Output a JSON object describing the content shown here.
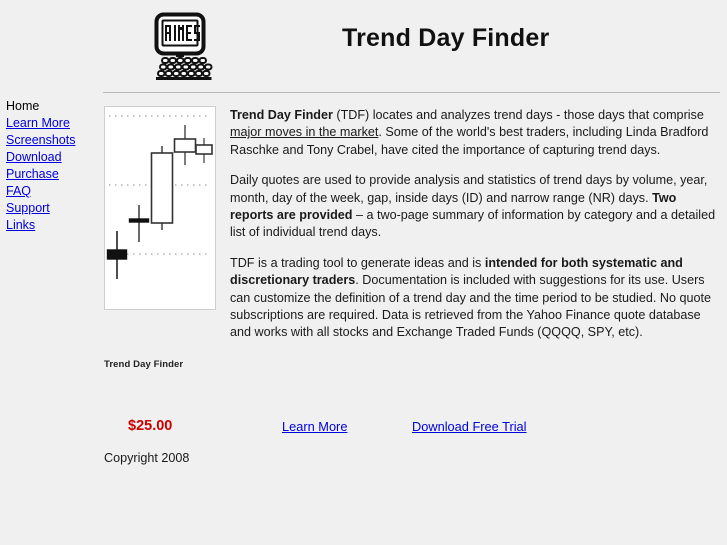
{
  "header": {
    "title": "Trend Day Finder",
    "logo_text": "AIMES",
    "logo_icon": "computer-monitor-keyboard-icon"
  },
  "sidebar": {
    "items": [
      {
        "label": "Home",
        "current": true
      },
      {
        "label": "Learn More",
        "current": false
      },
      {
        "label": "Screenshots",
        "current": false
      },
      {
        "label": "Download",
        "current": false
      },
      {
        "label": "Purchase",
        "current": false
      },
      {
        "label": "FAQ",
        "current": false
      },
      {
        "label": "Support",
        "current": false
      },
      {
        "label": "Links",
        "current": false
      }
    ]
  },
  "figure": {
    "caption": "Trend Day Finder",
    "alt": "candlestick-chart-icon"
  },
  "chart_data": {
    "type": "candlestick",
    "title": "",
    "xlabel": "",
    "ylabel": "",
    "grid": true,
    "gridlines": [
      3,
      2,
      1
    ],
    "ylim": [
      0,
      4
    ],
    "categories": [
      "1",
      "2",
      "3",
      "4",
      "5"
    ],
    "candles": [
      {
        "x": 1,
        "open": 1.12,
        "high": 1.48,
        "low": 0.78,
        "close": 0.96,
        "filled": true
      },
      {
        "x": 2,
        "open": 1.52,
        "high": 1.88,
        "low": 1.1,
        "close": 1.5,
        "filled": true
      },
      {
        "x": 3,
        "open": 1.55,
        "high": 2.88,
        "low": 1.5,
        "close": 2.8,
        "filled": false
      },
      {
        "x": 4,
        "open": 3.24,
        "high": 3.64,
        "low": 2.8,
        "close": 3.4,
        "filled": false
      },
      {
        "x": 5,
        "open": 3.14,
        "high": 3.42,
        "low": 2.9,
        "close": 3.24,
        "filled": false
      }
    ]
  },
  "paragraphs": {
    "p1": {
      "lead": "Trend Day Finder",
      "t1": " (TDF) locates and analyzes trend days - those days that comprise ",
      "underlined": "major moves in the market",
      "t2": ". Some of the world's best traders, including Linda Bradford Raschke and Tony Crabel, have cited the importance of capturing trend days."
    },
    "p2": {
      "t1": "Daily quotes are used to provide analysis and statistics of trend days by volume, year, month, day of the week, gap, inside days (ID) and narrow range (NR) days. ",
      "bold": "Two reports are provided",
      "t2": " – a two-page summary of information by category and a detailed list of individual trend days."
    },
    "p3": {
      "t1": "TDF is a trading tool to generate ideas and is ",
      "bold": "intended for both systematic and discretionary traders",
      "t2": ". Documentation is included with suggestions for its use. Users can customize the definition of a trend day and the time period to be studied. No quote subscriptions are required. Data is retrieved from the Yahoo Finance quote database and works with all stocks and Exchange Traded Funds (QQQQ, SPY, etc)."
    }
  },
  "actions": {
    "price": "$25.00",
    "learn_more": "Learn More",
    "download_trial": "Download Free Trial"
  },
  "footer": {
    "copyright": "Copyright 2008"
  },
  "colors": {
    "page_background": "#f0f0f0",
    "link": "#0000dd",
    "price": "#cc0000",
    "text": "#1a1a1a",
    "rule": "#b8b8b8"
  }
}
